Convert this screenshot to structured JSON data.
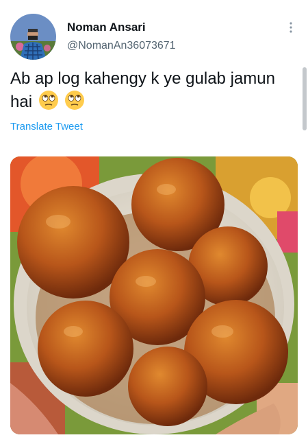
{
  "tweet": {
    "author_name": "Noman Ansari",
    "author_handle": "@NomanAn36073671",
    "text": "Ab ap log kahengy k ye gulab jamun hai",
    "emojis": [
      "face-with-rolling-eyes",
      "face-with-rolling-eyes"
    ],
    "translate_label": "Translate Tweet"
  },
  "icons": {
    "more": "more-vertical-dots-icon"
  },
  "colors": {
    "link": "#1d9bf0",
    "secondary_text": "#536471",
    "primary_text": "#0f1419"
  }
}
